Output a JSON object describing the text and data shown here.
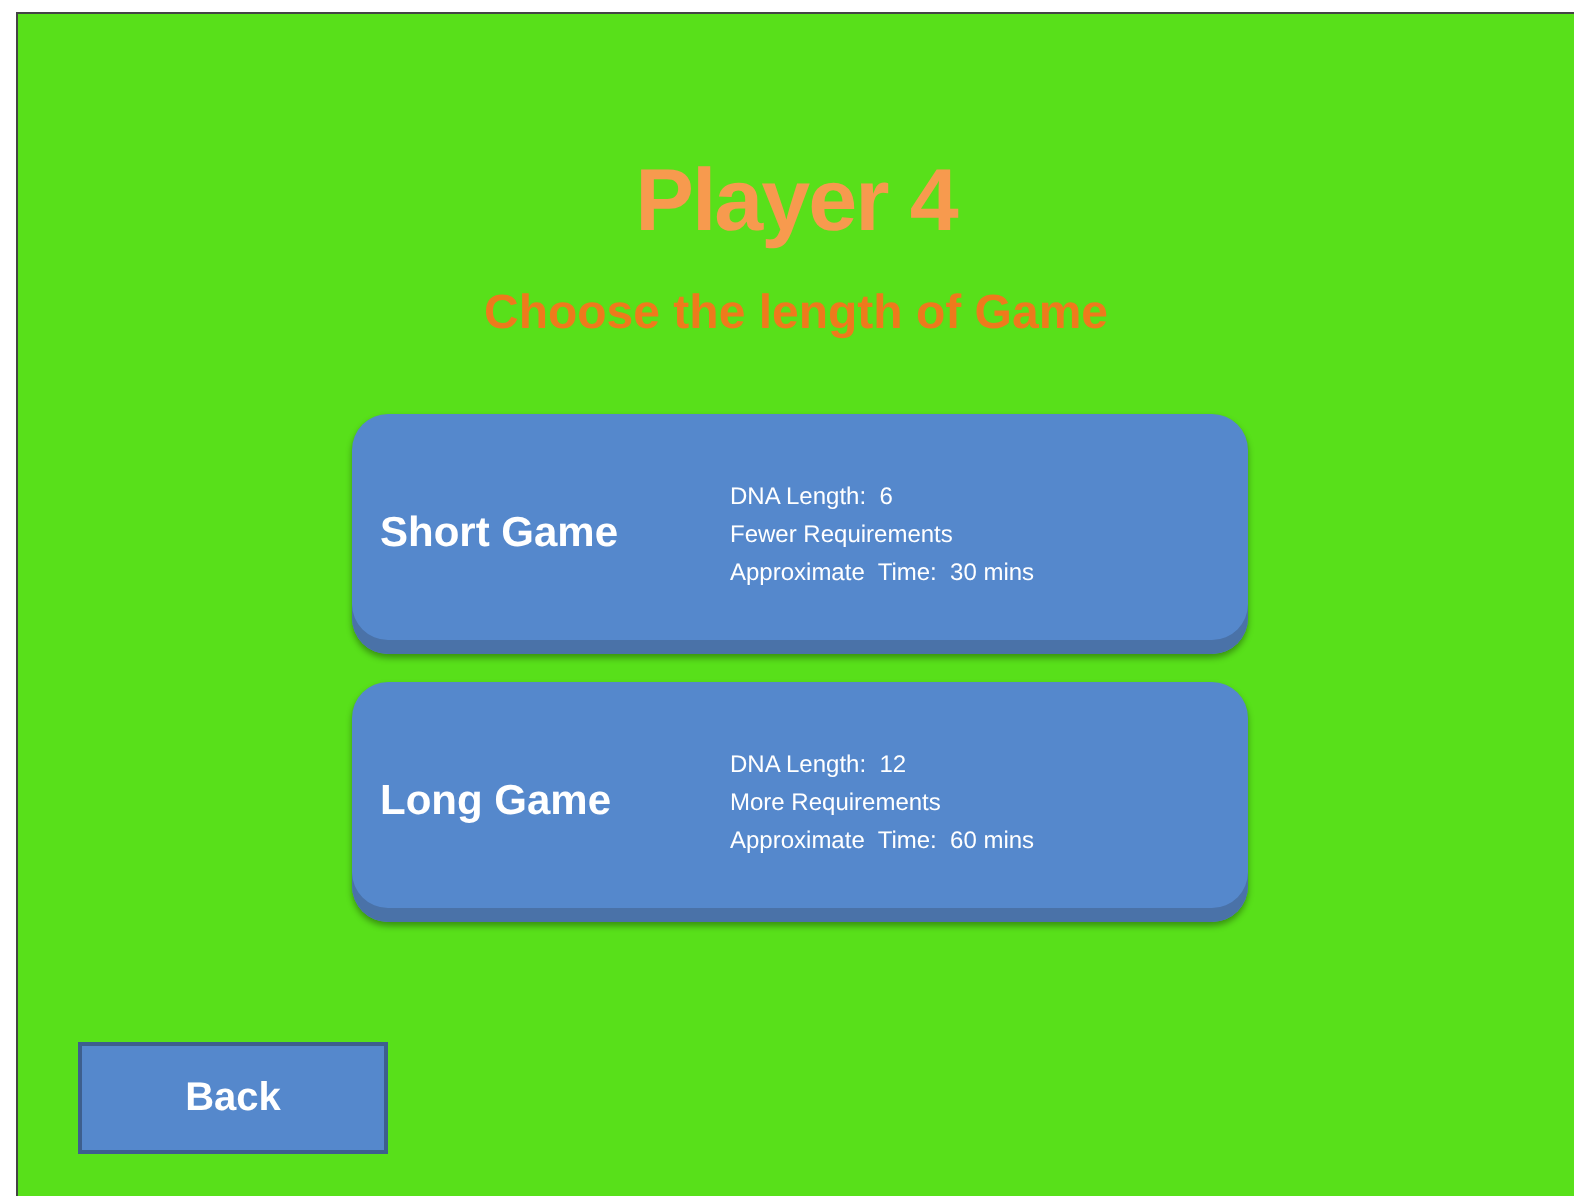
{
  "title": "Player 4",
  "subtitle": "Choose the length of Game",
  "options": [
    {
      "label": "Short Game",
      "details": [
        "DNA Length:  6",
        "Fewer Requirements",
        "Approximate  Time:  30 mins"
      ]
    },
    {
      "label": "Long Game",
      "details": [
        "DNA Length:  12",
        "More Requirements",
        "Approximate  Time:  60 mins"
      ]
    }
  ],
  "back_button": "Back"
}
